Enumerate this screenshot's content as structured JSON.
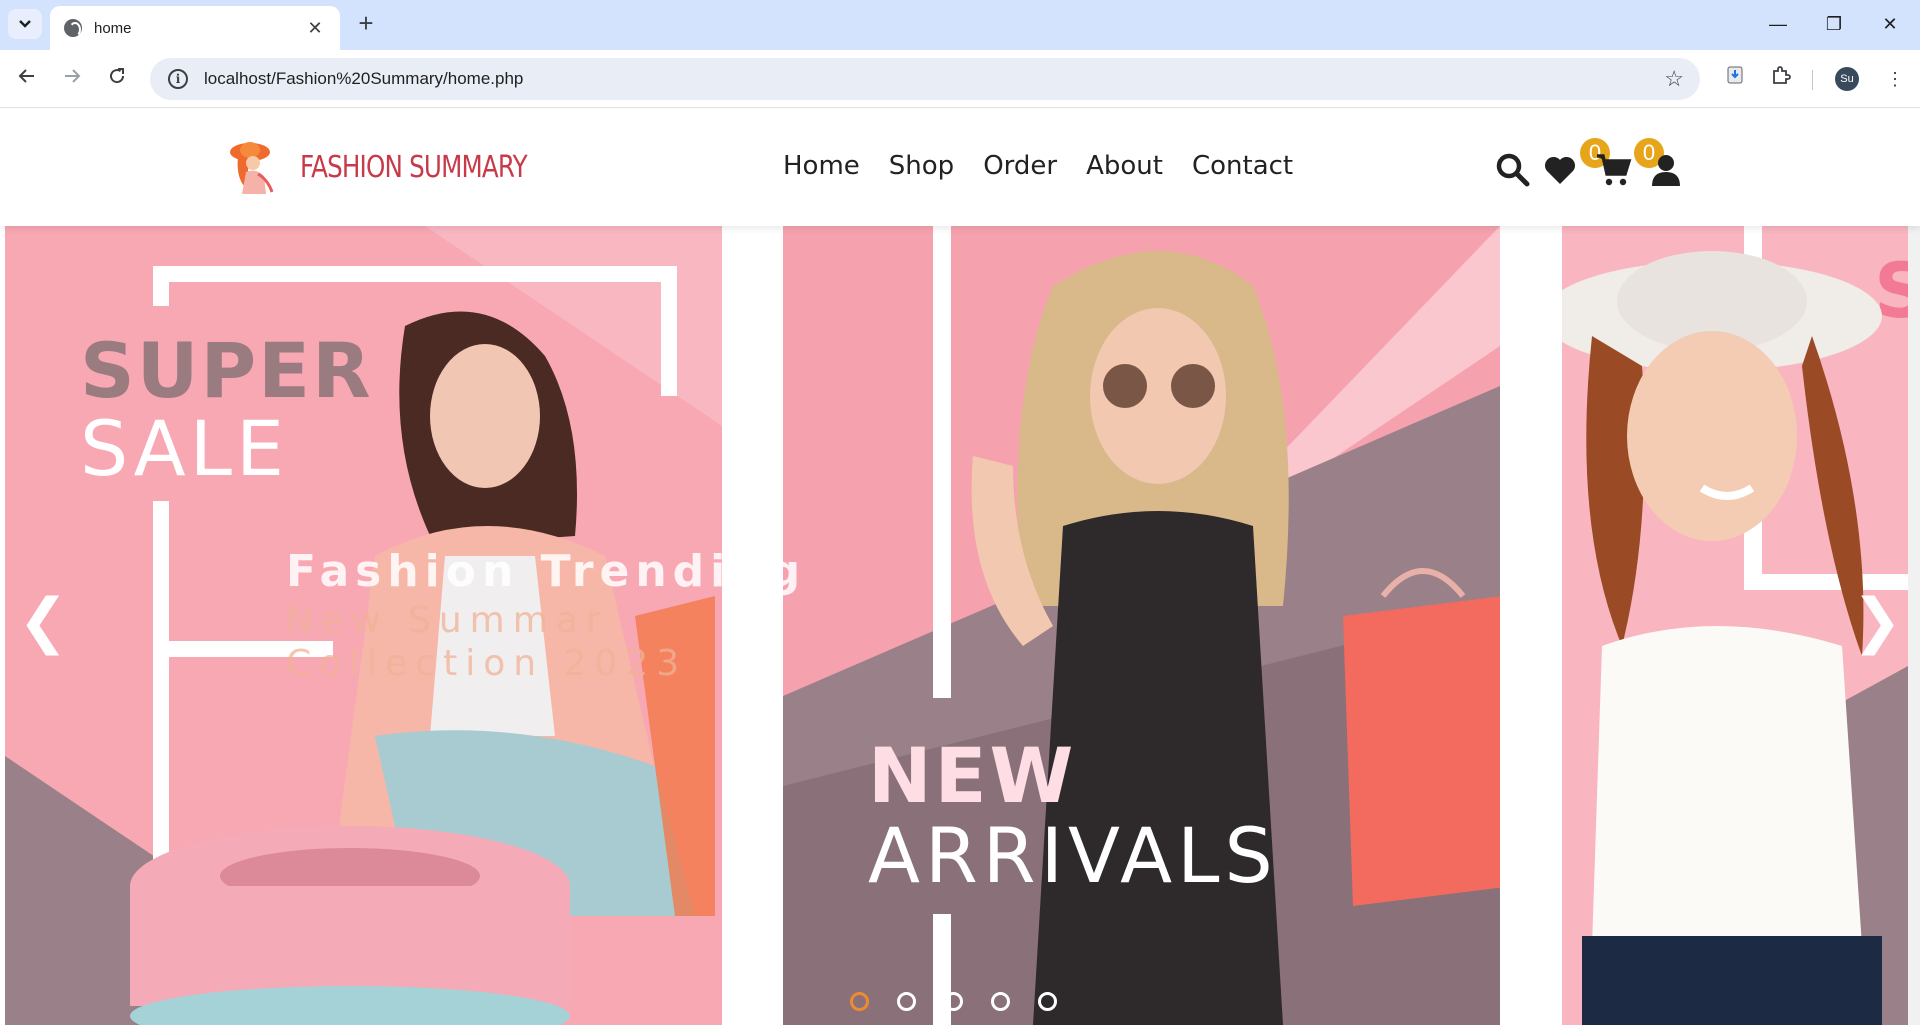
{
  "browser": {
    "tab_title": "home",
    "url": "localhost/Fashion%20Summary/home.php",
    "profile_initials": "Su"
  },
  "site": {
    "logo_text": "FASHION SUMMARY",
    "nav": [
      {
        "label": "Home"
      },
      {
        "label": "Shop"
      },
      {
        "label": "Order"
      },
      {
        "label": "About"
      },
      {
        "label": "Contact"
      }
    ],
    "wishlist_count": "0",
    "cart_count": "0",
    "colors": {
      "brand": "#c83a4a",
      "badge": "#e6a51a",
      "slide_pink": "#f8a8b3",
      "slide_mauve": "#9a8088",
      "active_dot": "#f08a30"
    }
  },
  "slider": {
    "slide1": {
      "line1": "SUPER",
      "line2": "SALE",
      "overlay_title": "Fashion Trending",
      "overlay_sub1": "New Summar",
      "overlay_sub2": "Collection 2023"
    },
    "slide2": {
      "line1": "NEW",
      "line2": "ARRIVALS"
    },
    "slide3": {
      "partial_text": "S"
    },
    "prev_arrow": "❮",
    "next_arrow": "❯",
    "dot_count": 5,
    "active_dot": 1
  }
}
